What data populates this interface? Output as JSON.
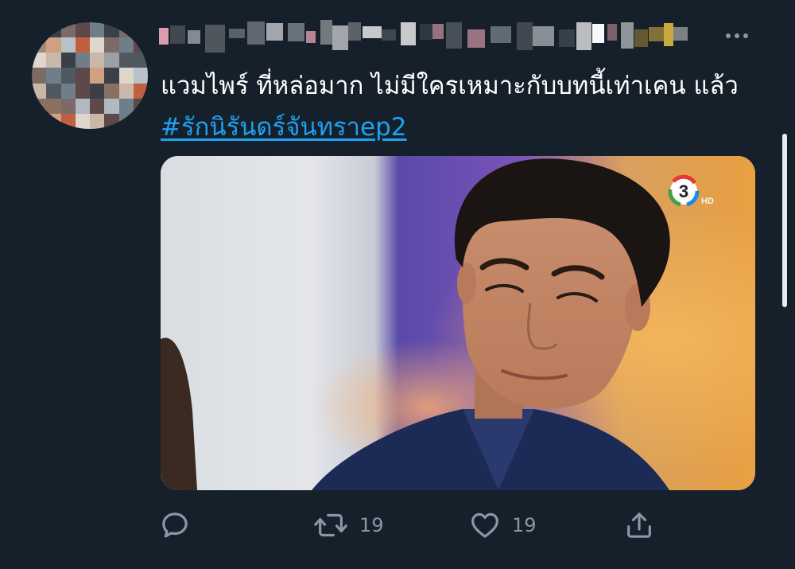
{
  "tweet": {
    "text_plain": "แวมไพร์  ที่หล่อมาก ไม่มีใครเหมาะกับบทนี้เท่าเคน แล้ว ",
    "hashtag": "#รักนิรันดร์จันทราep2",
    "media": {
      "channel_logo": "3",
      "channel_badge": "HD"
    }
  },
  "actions": {
    "reply": {
      "icon": "reply-icon"
    },
    "retweet": {
      "icon": "retweet-icon",
      "count": "19"
    },
    "like": {
      "icon": "heart-icon",
      "count": "19"
    },
    "share": {
      "icon": "share-icon"
    }
  },
  "colors": {
    "background": "#15202b",
    "text": "#ffffff",
    "link": "#1da1f2",
    "muted": "#8899a6"
  }
}
